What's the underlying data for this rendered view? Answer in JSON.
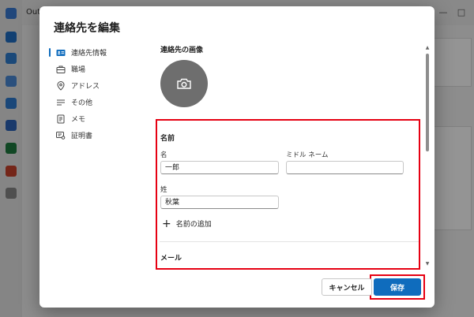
{
  "background": {
    "app_title": "Out"
  },
  "dialog": {
    "title": "連絡先を編集",
    "nav": [
      {
        "label": "連絡先情報",
        "icon": "contact-card-icon",
        "active": true
      },
      {
        "label": "職場",
        "icon": "briefcase-icon",
        "active": false
      },
      {
        "label": "アドレス",
        "icon": "location-icon",
        "active": false
      },
      {
        "label": "その他",
        "icon": "list-icon",
        "active": false
      },
      {
        "label": "メモ",
        "icon": "note-icon",
        "active": false
      },
      {
        "label": "証明書",
        "icon": "certificate-icon",
        "active": false
      }
    ],
    "photo_section_label": "連絡先の画像",
    "name_section": {
      "heading": "名前",
      "first_name_label": "名",
      "first_name_value": "一郎",
      "middle_name_label": "ミドル ネーム",
      "middle_name_value": "",
      "last_name_label": "姓",
      "last_name_value": "秋葉",
      "add_name_label": "名前の追加"
    },
    "email_section_heading": "メール",
    "cancel_label": "キャンセル",
    "save_label": "保存"
  },
  "colors": {
    "accent": "#0f6cbd",
    "highlight": "#e60012"
  }
}
